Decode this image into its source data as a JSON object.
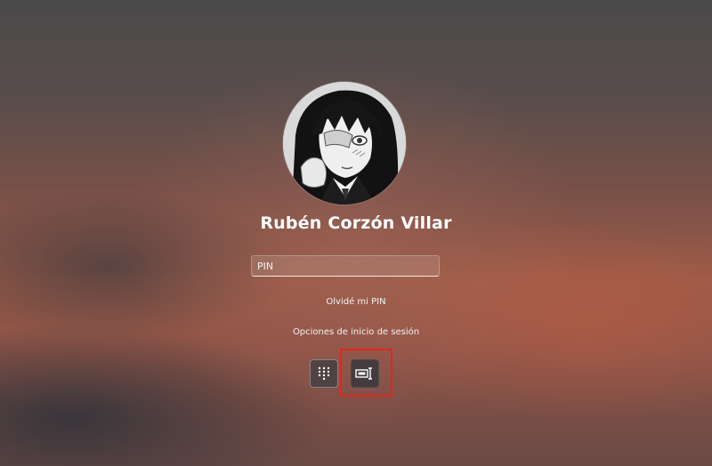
{
  "user": {
    "name": "Rubén Corzón Villar"
  },
  "pin": {
    "placeholder": "PIN",
    "value": ""
  },
  "links": {
    "forgot_pin": "Olvidé mi PIN",
    "signin_options": "Opciones de inicio de sesión"
  },
  "signin_methods": [
    {
      "icon": "keypad-icon",
      "name": "PIN"
    },
    {
      "icon": "password-key-icon",
      "name": "Password",
      "selected": true
    }
  ],
  "colors": {
    "highlight": "#e0261f",
    "text": "#ffffff"
  }
}
